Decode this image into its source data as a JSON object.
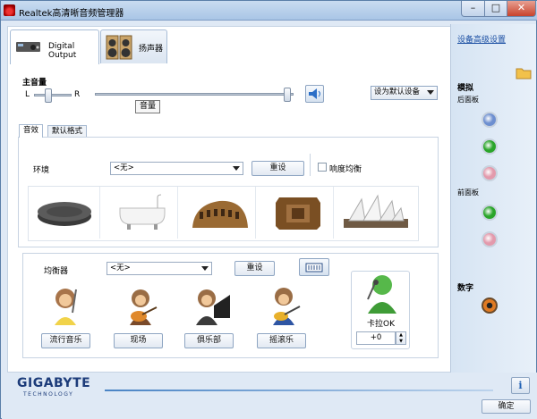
{
  "window": {
    "title": "Realtek高清晰音频管理器",
    "min": "–",
    "max": "□",
    "close": "✕"
  },
  "tabs": [
    {
      "label": "Digital Output",
      "icon": "digital-output-device-icon"
    },
    {
      "label": "扬声器",
      "icon": "speaker-icon"
    }
  ],
  "volume": {
    "heading": "主音量",
    "left": "L",
    "right": "R",
    "tooltip": "音量",
    "set_default": "设为默认设备",
    "balance_level": 0.32,
    "volume_level": 0.98
  },
  "subtabs": [
    "音效",
    "默认格式"
  ],
  "environment": {
    "label": "环境",
    "value": "<无>",
    "reset": "重设",
    "loudness": "响度均衡",
    "presets": [
      "stone-disc",
      "bathtub",
      "colosseum",
      "wooden-room",
      "opera-house"
    ]
  },
  "equalizer": {
    "label": "均衡器",
    "value": "<无>",
    "reset": "重设",
    "presets": [
      "流行音乐",
      "现场",
      "俱乐部",
      "摇滚乐"
    ]
  },
  "karaoke": {
    "label": "卡拉OK",
    "value": "+0"
  },
  "right_panel": {
    "advanced_link": "设备高级设置",
    "analog_heading": "模拟",
    "rear_label": "后面板",
    "front_label": "前面板",
    "digital_heading": "数字",
    "colors": {
      "blue": "#6d8fd0",
      "green": "#2aa52a",
      "pink": "#e39aac",
      "orange": "#e07a22"
    }
  },
  "footer": {
    "brand": "GIGABYTE",
    "brand_sub": "TECHNOLOGY",
    "ok": "确定",
    "info_icon": "i"
  }
}
